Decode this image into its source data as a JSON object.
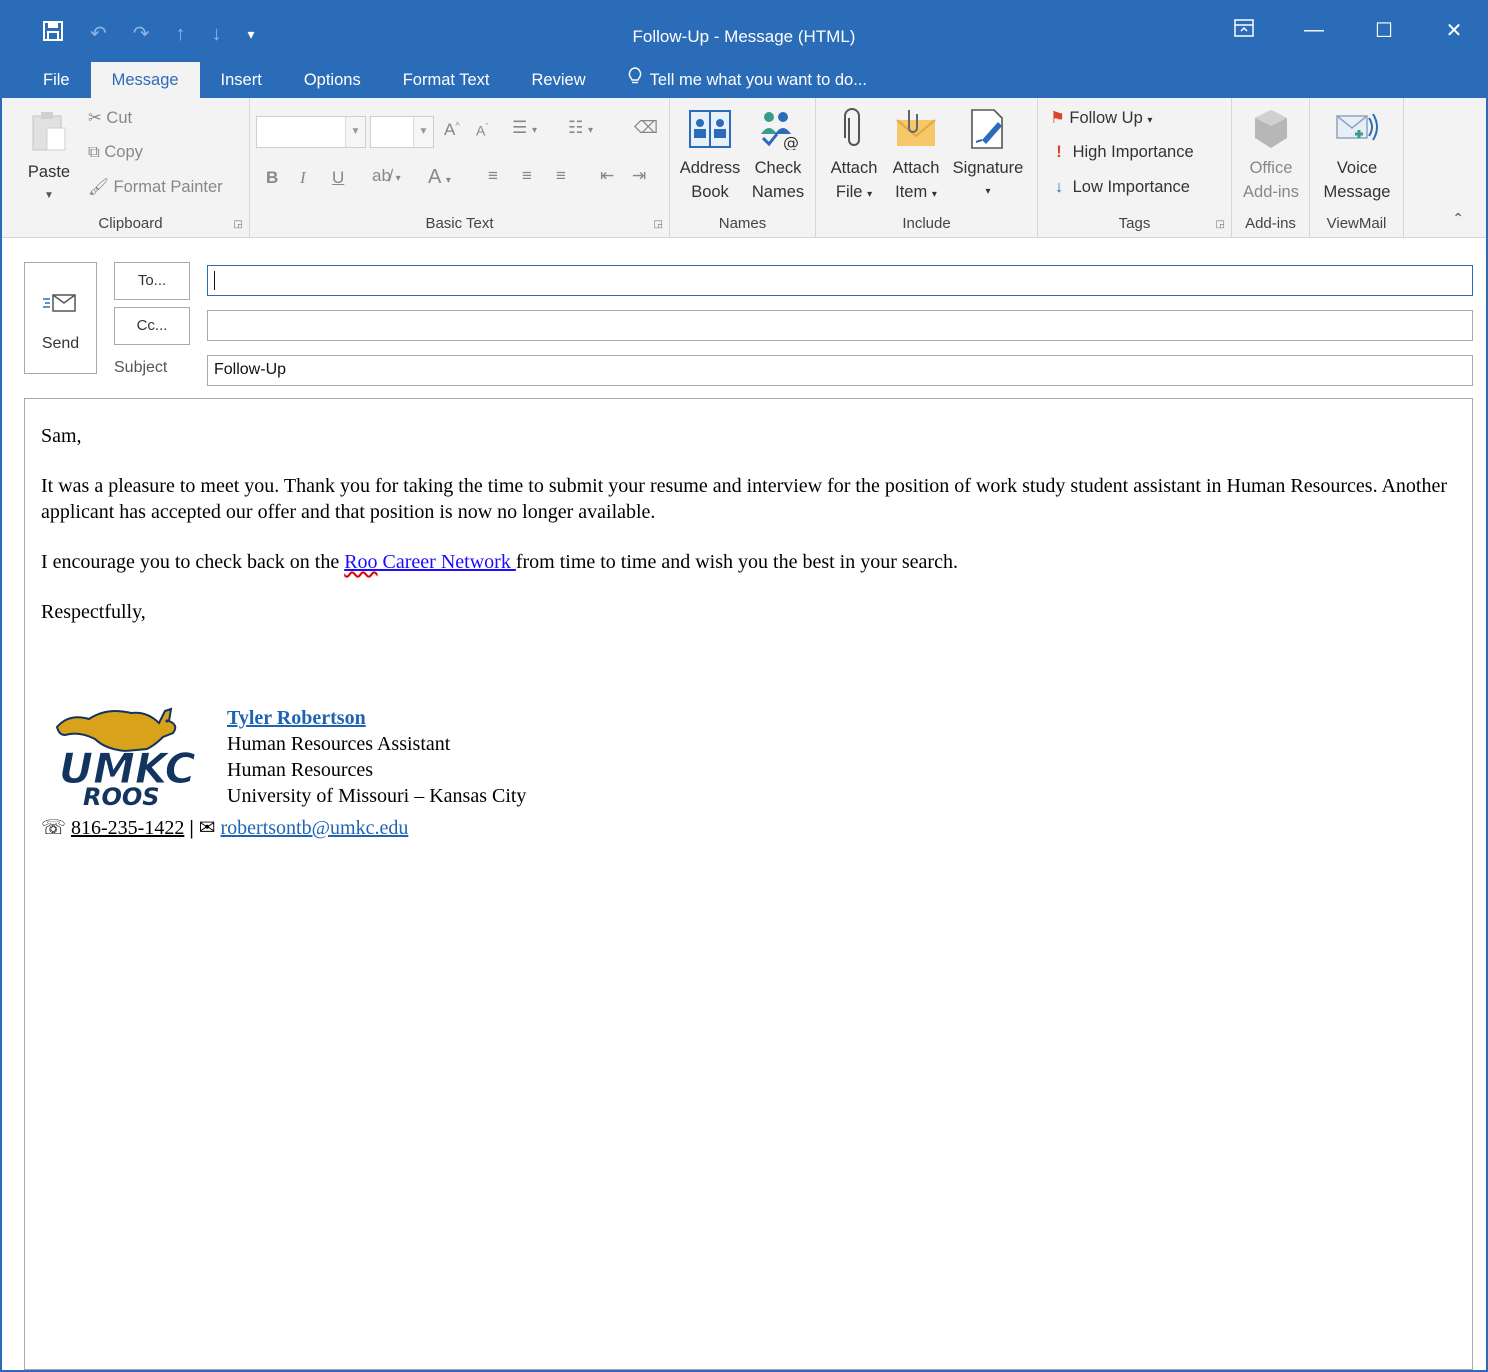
{
  "window": {
    "title": "Follow-Up - Message (HTML)"
  },
  "tabs": [
    {
      "label": "File"
    },
    {
      "label": "Message"
    },
    {
      "label": "Insert"
    },
    {
      "label": "Options"
    },
    {
      "label": "Format Text"
    },
    {
      "label": "Review"
    }
  ],
  "tell_me": "Tell me what you want to do...",
  "ribbon": {
    "clipboard": {
      "label": "Clipboard",
      "paste": "Paste",
      "cut": "Cut",
      "copy": "Copy",
      "format_painter": "Format Painter"
    },
    "basic_text": {
      "label": "Basic Text",
      "bold": "B",
      "italic": "I",
      "underline": "U",
      "font_color": "A"
    },
    "names": {
      "label": "Names",
      "address_book": [
        "Address",
        "Book"
      ],
      "check_names": [
        "Check",
        "Names"
      ]
    },
    "include": {
      "label": "Include",
      "attach_file": [
        "Attach",
        "File"
      ],
      "attach_item": [
        "Attach",
        "Item"
      ],
      "signature": "Signature"
    },
    "tags": {
      "label": "Tags",
      "follow_up": "Follow Up",
      "high_importance": "High Importance",
      "low_importance": "Low Importance"
    },
    "addins": {
      "label": "Add-ins",
      "office_addins": [
        "Office",
        "Add-ins"
      ]
    },
    "viewmail": {
      "label": "ViewMail",
      "voice_message": [
        "Voice",
        "Message"
      ]
    }
  },
  "compose": {
    "send": "Send",
    "to_button": "To...",
    "cc_button": "Cc...",
    "subject_label": "Subject",
    "to_value": "",
    "cc_value": "",
    "subject_value": "Follow-Up"
  },
  "message": {
    "greeting": "Sam,",
    "para1": "It was a pleasure to meet you. Thank you for taking the time to submit your resume and interview for the position of work study student assistant in Human Resources. Another applicant has accepted our offer and that position is now no longer available.",
    "para2_before": "I encourage you to check back on the ",
    "para2_link_word1": "Roo",
    "para2_link_rest": " Career Network ",
    "para2_after": "from time to time and wish you the best in your search.",
    "closing": "Respectfully,",
    "signature": {
      "name": "Tyler Robertson",
      "title": "Human Resources Assistant",
      "department": "Human Resources",
      "university": "University of Missouri – Kansas City",
      "phone": "816-235-1422",
      "separator": "|",
      "email": "robertsontb@umkc.edu",
      "logo_text_top": "UMKC",
      "logo_text_bottom": "ROOS"
    }
  },
  "colors": {
    "accent": "#2b6cb8",
    "link": "#1a0dff",
    "signature_link": "#1f63b3",
    "logo_gold": "#d9a21b",
    "logo_navy": "#12345e"
  }
}
